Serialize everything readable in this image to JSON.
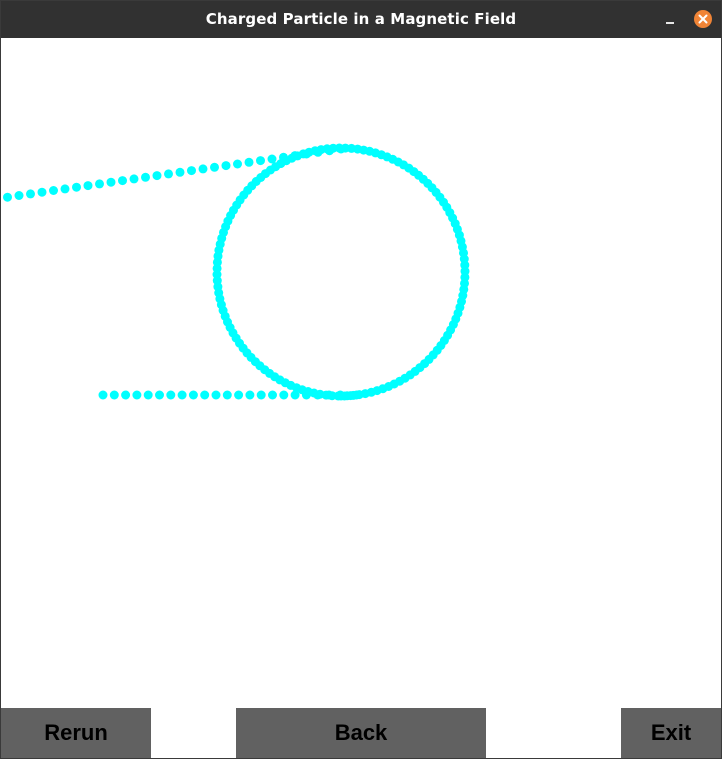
{
  "window": {
    "title": "Charged Particle in a Magnetic Field",
    "minimize_icon": "minimize-icon",
    "close_icon": "close-icon"
  },
  "simulation": {
    "particle_color": "#00ffff",
    "background_color": "#ffffff"
  },
  "buttons": {
    "rerun_label": "Rerun",
    "back_label": "Back",
    "exit_label": "Exit",
    "button_color": "#616161"
  },
  "colors": {
    "titlebar": "#313131",
    "close_button": "#f08436"
  }
}
